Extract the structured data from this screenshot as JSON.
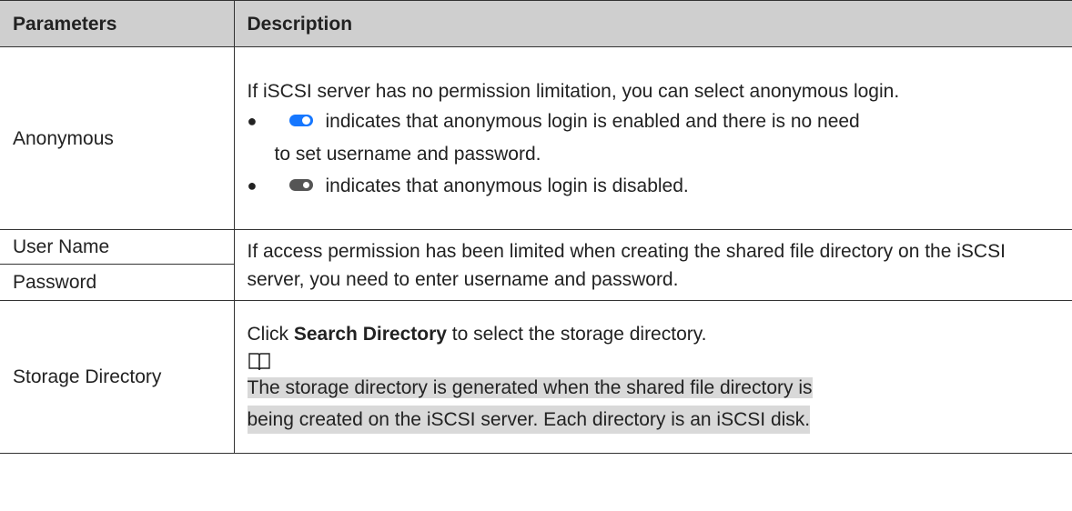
{
  "header": {
    "col1": "Parameters",
    "col2": "Description"
  },
  "anonymous": {
    "name": "Anonymous",
    "intro": "If iSCSI server has no permission limitation, you can select anonymous login.",
    "bullet_on_line1": "indicates that anonymous login is enabled and there is no need",
    "bullet_on_line2": "to set username and password.",
    "bullet_off": "indicates that anonymous login is disabled."
  },
  "credentials": {
    "user_name": "User Name",
    "password": "Password",
    "description": "If access permission has been limited when creating the shared file directory on the iSCSI server, you need to enter username and password."
  },
  "storage": {
    "name": "Storage Directory",
    "click_prefix": "Click ",
    "click_button": "Search Directory",
    "click_suffix": " to select the storage directory.",
    "note_line1": "The storage directory is generated when the shared file directory is ",
    "note_line2": "being created on the iSCSI server. Each directory is an iSCSI disk."
  },
  "colors": {
    "header_bg": "#cfcfcf",
    "toggle_on": "#1677ff",
    "toggle_off": "#555555",
    "note_highlight": "#d9d9d9"
  },
  "icons": {
    "bullet": "●",
    "note": "book-icon"
  }
}
